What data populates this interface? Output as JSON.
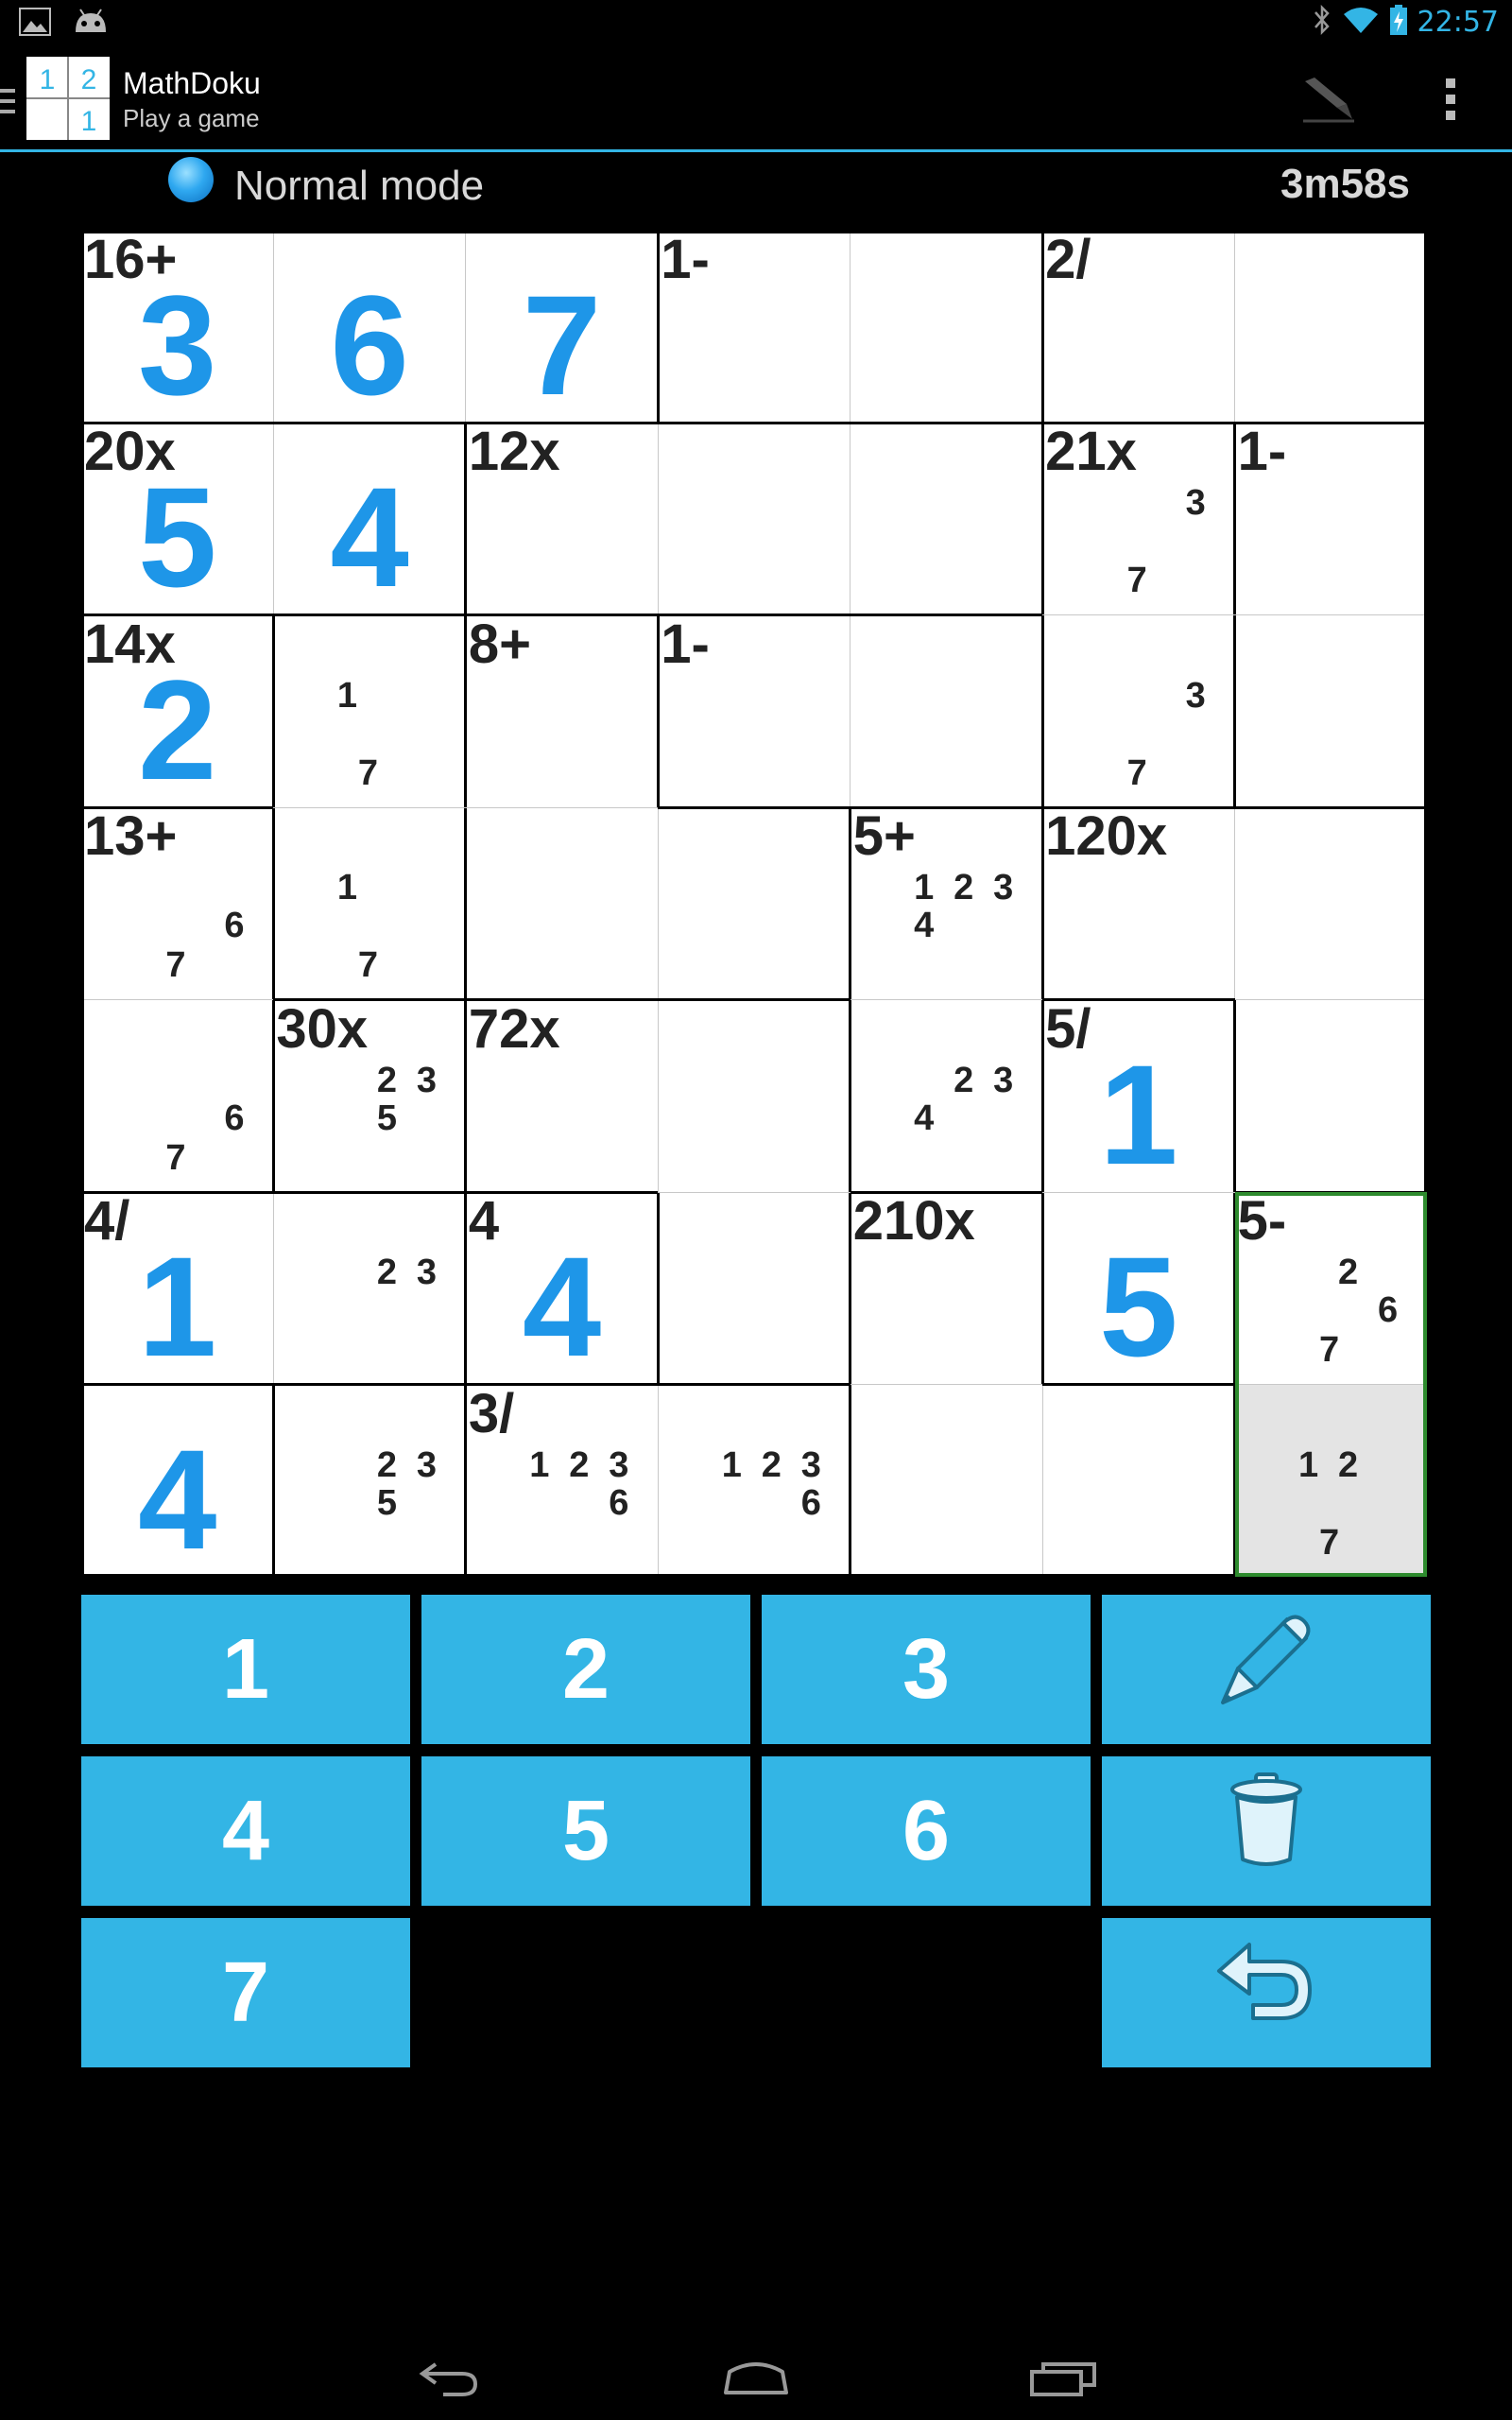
{
  "status_bar": {
    "clock": "22:57",
    "left_icons": [
      "gallery-icon",
      "android-icon"
    ],
    "right_icons": [
      "bluetooth-icon",
      "wifi-icon",
      "battery-charging-icon"
    ]
  },
  "action_bar": {
    "app_title": "MathDoku",
    "subtitle": "Play a game",
    "logo_digits": [
      "1",
      "2",
      "1"
    ],
    "actions": [
      "pen-icon",
      "overflow-menu-icon"
    ]
  },
  "game": {
    "mode_label": "Normal mode",
    "timer": "3m58s",
    "grid_size": 7,
    "cells": [
      [
        {
          "cage": "16+",
          "value": "3"
        },
        {
          "value": "6"
        },
        {
          "value": "7"
        },
        {
          "cage": "1-"
        },
        {},
        {
          "cage": "2/"
        },
        {}
      ],
      [
        {
          "cage": "20x",
          "value": "5"
        },
        {
          "value": "4"
        },
        {
          "cage": "12x"
        },
        {},
        {},
        {
          "cage": "21x",
          "marks": [
            "3",
            "7"
          ]
        },
        {
          "cage": "1-"
        }
      ],
      [
        {
          "cage": "14x",
          "value": "2"
        },
        {
          "marks": [
            "1",
            "7"
          ]
        },
        {
          "cage": "8+"
        },
        {
          "cage": "1-"
        },
        {},
        {
          "marks": [
            "3",
            "7"
          ]
        },
        {}
      ],
      [
        {
          "cage": "13+",
          "marks": [
            "6",
            "7"
          ]
        },
        {
          "marks": [
            "1",
            "7"
          ]
        },
        {},
        {},
        {
          "cage": "5+",
          "marks": [
            "1",
            "2",
            "3",
            "4"
          ]
        },
        {
          "cage": "120x"
        },
        {}
      ],
      [
        {
          "marks": [
            "6",
            "7"
          ]
        },
        {
          "cage": "30x",
          "marks": [
            "2",
            "3",
            "5"
          ]
        },
        {
          "cage": "72x"
        },
        {},
        {
          "marks": [
            "2",
            "3",
            "4"
          ]
        },
        {
          "cage": "5/",
          "value": "1"
        },
        {}
      ],
      [
        {
          "cage": "4/",
          "value": "1"
        },
        {
          "marks": [
            "2",
            "3"
          ]
        },
        {
          "cage": "4",
          "value": "4"
        },
        {},
        {
          "cage": "210x"
        },
        {
          "value": "5"
        },
        {
          "cage": "5-",
          "marks": [
            "2",
            "6",
            "7"
          ]
        }
      ],
      [
        {
          "value": "4"
        },
        {
          "marks": [
            "2",
            "3",
            "5"
          ]
        },
        {
          "cage": "3/",
          "marks": [
            "1",
            "2",
            "3",
            "6"
          ]
        },
        {
          "marks": [
            "1",
            "2",
            "3",
            "6"
          ]
        },
        {},
        {},
        {
          "marks": [
            "1",
            "2",
            "7"
          ]
        }
      ]
    ],
    "selected_cell": {
      "row": 6,
      "col": 6
    }
  },
  "keypad": {
    "digits": [
      "1",
      "2",
      "3",
      "4",
      "5",
      "6",
      "7"
    ],
    "tools": [
      "pencil-icon",
      "trash-icon",
      "undo-icon"
    ]
  },
  "navigation": [
    "back-icon",
    "home-icon",
    "recent-apps-icon"
  ]
}
